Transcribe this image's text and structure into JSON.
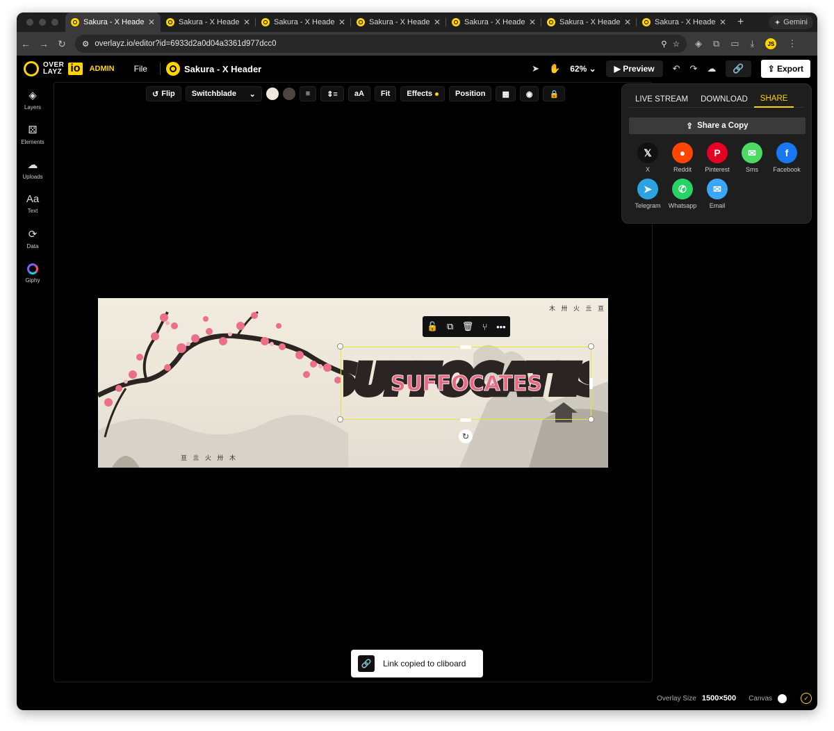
{
  "browser": {
    "tabs": [
      {
        "title": "Sakura - X Header - T"
      },
      {
        "title": "Sakura - X Header - T"
      },
      {
        "title": "Sakura - X Header - T"
      },
      {
        "title": "Sakura - X Header - T"
      },
      {
        "title": "Sakura - X Header - T"
      },
      {
        "title": "Sakura - X Header - T"
      },
      {
        "title": "Sakura - X Header - T"
      }
    ],
    "gemini_label": "Gemini",
    "url": "overlayz.io/editor?id=6933d2a0d04a3361d977dcc0"
  },
  "app": {
    "logo_word_top": "OVER",
    "logo_word_bottom": "LAYZ",
    "logo_io": "io",
    "admin_label": "ADMIN",
    "file_menu": "File",
    "project_name": "Sakura - X Header",
    "zoom_label": "62%",
    "preview_label": "Preview",
    "export_label": "Export"
  },
  "sidebar": {
    "items": [
      {
        "label": "Layers",
        "icon": "layers-icon"
      },
      {
        "label": "Elements",
        "icon": "elements-icon"
      },
      {
        "label": "Uploads",
        "icon": "upload-cloud-icon"
      },
      {
        "label": "Text",
        "icon": "text-icon"
      },
      {
        "label": "Data",
        "icon": "data-sync-icon"
      },
      {
        "label": "Giphy",
        "icon": "giphy-icon"
      }
    ]
  },
  "properties": {
    "flip_label": "Flip",
    "font_name": "Switchblade",
    "swatch1": "#f0e8da",
    "swatch2": "#4a4540",
    "case_label": "aA",
    "fit_label": "Fit",
    "effects_label": "Effects",
    "position_label": "Position"
  },
  "canvas": {
    "headline_text": "SUFFOCATES",
    "kanji_top_right": "木 卅 火 亖 亘",
    "kanji_bottom_left": "亘 亖 火 卅 木",
    "accent_pink": "#e76a85"
  },
  "share_panel": {
    "tabs": [
      {
        "label": "LIVE STREAM"
      },
      {
        "label": "DOWNLOAD"
      },
      {
        "label": "SHARE"
      }
    ],
    "copy_label": "Share a Copy",
    "items": [
      {
        "label": "X",
        "glyph": "𝕏",
        "color": "#111111"
      },
      {
        "label": "Reddit",
        "glyph": "●",
        "color": "#ff4500"
      },
      {
        "label": "Pinterest",
        "glyph": "P",
        "color": "#e60023"
      },
      {
        "label": "Sms",
        "glyph": "✉",
        "color": "#4cd964"
      },
      {
        "label": "Facebook",
        "glyph": "f",
        "color": "#1877f2"
      },
      {
        "label": "Telegram",
        "glyph": "➤",
        "color": "#2aa3df"
      },
      {
        "label": "Whatsapp",
        "glyph": "✆",
        "color": "#25d366"
      },
      {
        "label": "Email",
        "glyph": "✉",
        "color": "#3ba6f5"
      }
    ]
  },
  "toast": {
    "message": "Link copied to cliboard"
  },
  "footer": {
    "overlay_size_label": "Overlay Size",
    "overlay_size_value": "1500×500",
    "canvas_label": "Canvas"
  }
}
